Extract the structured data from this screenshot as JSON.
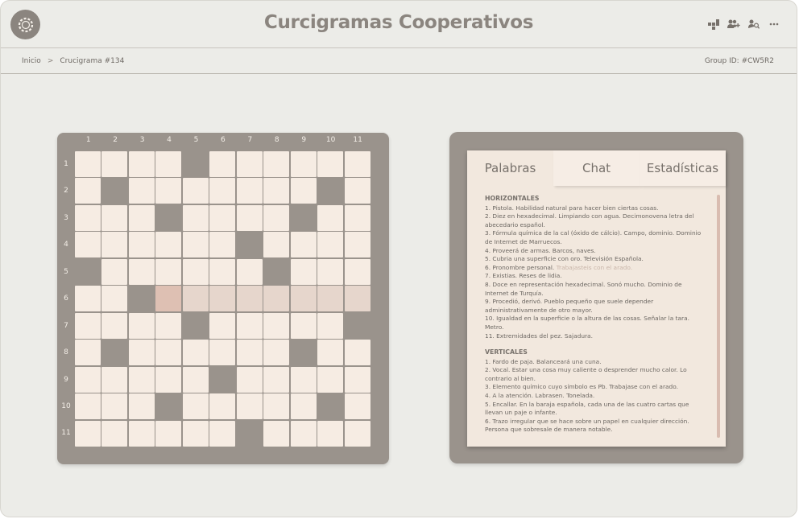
{
  "app": {
    "title": "Curcigramas Cooperativos"
  },
  "header": {
    "actions": [
      "puzzle-icon",
      "add-user-icon",
      "search-user-icon",
      "more-icon"
    ]
  },
  "breadcrumb": {
    "items": [
      "Inicio",
      "Crucigrama #134"
    ],
    "separator": ">"
  },
  "group": {
    "label": "Group ID: #CW5R2"
  },
  "board": {
    "size": 11,
    "col_numbers": [
      "1",
      "2",
      "3",
      "4",
      "5",
      "6",
      "7",
      "8",
      "9",
      "10",
      "11"
    ],
    "row_numbers": [
      "1",
      "2",
      "3",
      "4",
      "5",
      "6",
      "7",
      "8",
      "9",
      "10",
      "11"
    ],
    "rows": [
      "1111011111.",
      "1011111101.",
      "1110111011.",
      "1111101111.",
      "0111110111.",
      "1101111111.",
      "1111011110.",
      "1011111011.",
      "1111101111.",
      "1110111101.",
      "1111110111."
    ],
    "highlight_row": 6,
    "highlight_cols": [
      4,
      5,
      6,
      7,
      8,
      9,
      10,
      11
    ],
    "active_cell": [
      6,
      4
    ]
  },
  "panel": {
    "tabs": [
      "Palabras",
      "Chat",
      "Estadísticas"
    ],
    "active_tab": "Palabras",
    "horizontal_title": "HORIZONTALES",
    "horizontal": [
      "1. Pistola. Habilidad natural para hacer bien ciertas cosas.",
      "2. Diez en hexadecimal. Limpiando con agua. Decimonovena letra del abecedario español.",
      "3. Fórmula química de la cal (óxido de cálcio). Campo, dominio. Dominio de Internet de Marruecos.",
      "4. Proveerá de armas. Barcos, naves.",
      "5. Cubria una superficie con oro. Televisión Española.",
      "6. Pronombre personal.",
      "7. Existias. Reses de lidia.",
      "8. Doce en representación hexadecimal. Sonó mucho. Dominio de Internet de Turquía.",
      "9. Procedió, derivó. Pueblo pequeño que suele depender administrativamente de otro mayor.",
      "10. Igualdad en la superficie o la altura de las cosas. Señalar la tara. Metro.",
      "11. Extremidades del pez. Sajadura."
    ],
    "horizontal_6_extra": "Trabajasteis con el arado.",
    "vertical_title": "VERTICALES",
    "vertical": [
      "1. Fardo de paja. Balanceará una cuna.",
      "2. Vocal. Estar una cosa muy caliente o desprender mucho calor. Lo contrario al bien.",
      "3. Elemento químico cuyo símbolo es Pb. Trabajase con el arado.",
      "4. A la atención. Labrasen. Tonelada.",
      "5. Encallar. En la baraja española, cada una de las cuatro cartas que llevan un paje o infante.",
      "6. Trazo irregular que se hace sobre un papel en cualquier dirección. Persona que sobresale de manera notable."
    ]
  },
  "colors": {
    "background": "#ecece8",
    "board": "#9a938c",
    "cell": "#f6ece3",
    "highlight": "#e6d6cc",
    "active": "#dec0b3",
    "text": "#77716b"
  }
}
